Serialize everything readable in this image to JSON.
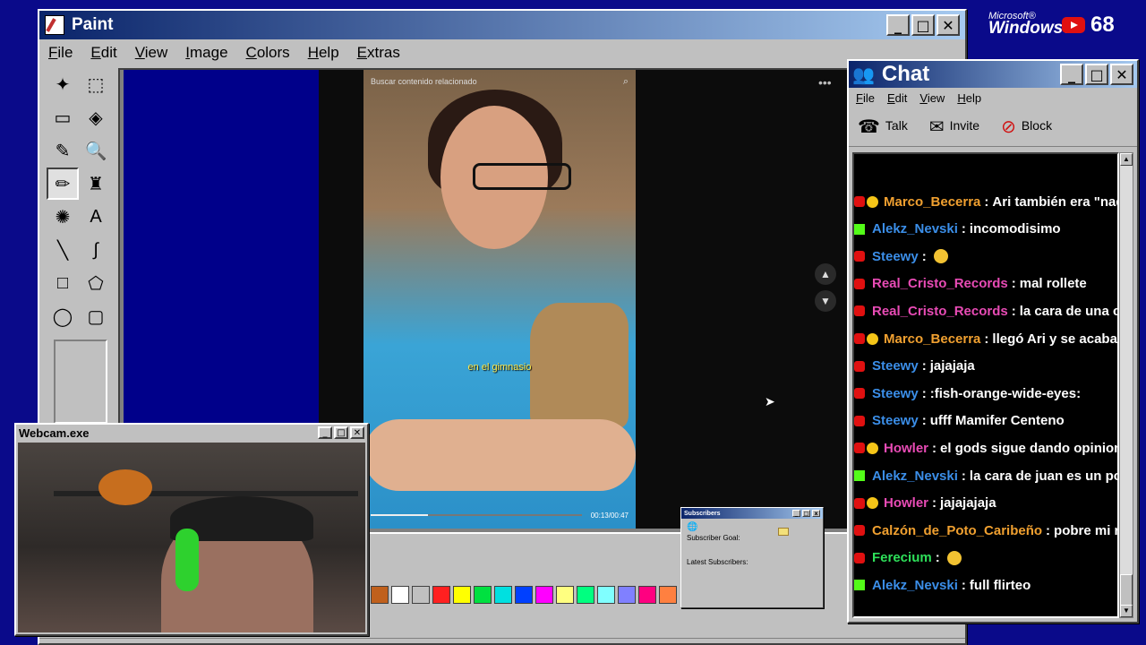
{
  "branding": {
    "ms_text": "Microsoft®",
    "os_text": "Windows98",
    "viewer_count": "68"
  },
  "paint": {
    "title": "Paint",
    "menu": [
      "File",
      "Edit",
      "View",
      "Image",
      "Colors",
      "Help",
      "Extras"
    ],
    "tools": [
      "free-select",
      "rect-select",
      "eraser",
      "fill",
      "color-picker",
      "magnifier",
      "pencil",
      "brush",
      "airbrush",
      "text",
      "line",
      "curve",
      "rectangle",
      "polygon",
      "ellipse",
      "rounded-rectangle"
    ],
    "tool_glyphs": [
      "✦",
      "⬚",
      "▭",
      "◈",
      "✎",
      "🔍",
      "✏",
      "♜",
      "✺",
      "A",
      "╲",
      "∫",
      "□",
      "⬠",
      "◯",
      "▢"
    ],
    "palette": [
      "#c0601c",
      "#ffffff",
      "#c0c0c0",
      "#ff2020",
      "#ffff00",
      "#00e040",
      "#00e0e0",
      "#0040ff",
      "#ff00ff",
      "#ffff80",
      "#00ff80",
      "#80ffff",
      "#8080ff",
      "#ff0080",
      "#ff8040"
    ],
    "video": {
      "search_placeholder": "Buscar contenido relacionado",
      "caption": "en el gimnasio",
      "time": "00:13/00:47",
      "progress": 0.27
    }
  },
  "subscribers": {
    "title": "Subscribers",
    "goal_label": "Subscriber Goal:",
    "latest_label": "Latest Subscribers:"
  },
  "webcam": {
    "title": "Webcam.exe"
  },
  "chat": {
    "title": "Chat",
    "menu": [
      "File",
      "Edit",
      "View",
      "Help"
    ],
    "tools": [
      {
        "label": "Talk",
        "icon": "talk-icon",
        "glyph": "☎"
      },
      {
        "label": "Invite",
        "icon": "invite-icon",
        "glyph": "✉"
      },
      {
        "label": "Block",
        "icon": "block-icon",
        "glyph": "⊘"
      }
    ],
    "messages": [
      {
        "platform": "youtube",
        "star": true,
        "user": "Marco_Becerra",
        "color": "#f0a030",
        "text": "Ari también era \"nada \""
      },
      {
        "platform": "kick",
        "star": false,
        "user": "Alekz_Nevski",
        "color": "#3b8ee8",
        "text": "incomodisimo"
      },
      {
        "platform": "youtube",
        "star": false,
        "user": "Steewy",
        "color": "#3b8ee8",
        "text": "",
        "emote": true
      },
      {
        "platform": "youtube",
        "star": false,
        "user": "Real_Cristo_Records",
        "color": "#e84bb5",
        "text": "mal rollete"
      },
      {
        "platform": "youtube",
        "star": false,
        "user": "Real_Cristo_Records",
        "color": "#e84bb5",
        "text": "la cara de una cuerr"
      },
      {
        "platform": "youtube",
        "star": true,
        "user": "Marco_Becerra",
        "color": "#f0a030",
        "text": "llegó Ari y se acabaron"
      },
      {
        "platform": "youtube",
        "star": false,
        "user": "Steewy",
        "color": "#3b8ee8",
        "text": "jajajaja"
      },
      {
        "platform": "youtube",
        "star": false,
        "user": "Steewy",
        "color": "#3b8ee8",
        "text": ":fish-orange-wide-eyes:"
      },
      {
        "platform": "youtube",
        "star": false,
        "user": "Steewy",
        "color": "#3b8ee8",
        "text": "ufff Mamifer Centeno"
      },
      {
        "platform": "youtube",
        "star": true,
        "user": "Howler",
        "color": "#e84bb5",
        "text": "el gods sigue dando opiniones e"
      },
      {
        "platform": "kick",
        "star": false,
        "user": "Alekz_Nevski",
        "color": "#3b8ee8",
        "text": "la cara de juan es un poema"
      },
      {
        "platform": "youtube",
        "star": true,
        "user": "Howler",
        "color": "#e84bb5",
        "text": "jajajajaja"
      },
      {
        "platform": "youtube",
        "star": false,
        "user": "Calzón_de_Poto_Caribeño",
        "color": "#f0a030",
        "text": "pobre mi reina"
      },
      {
        "platform": "youtube",
        "star": false,
        "user": "Ferecium",
        "color": "#2ee05a",
        "text": "",
        "emote": true
      },
      {
        "platform": "kick",
        "star": false,
        "user": "Alekz_Nevski",
        "color": "#3b8ee8",
        "text": "full flirteo"
      }
    ]
  }
}
